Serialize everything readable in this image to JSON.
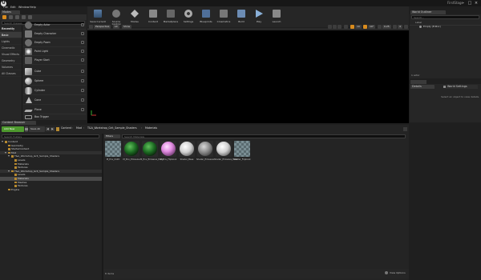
{
  "app": {
    "window_title": "FirstStage",
    "logo_letter": "U",
    "menus": [
      "File",
      "Edit",
      "Window",
      "Help"
    ]
  },
  "modes_tab": "Modes",
  "place_tab": "Place Mode",
  "place_search": "Search Classes",
  "categories": [
    {
      "label": "Recently Placed",
      "bold": true
    },
    {
      "label": "Basic",
      "selected": true
    },
    {
      "label": "Lights"
    },
    {
      "label": "Cinematic"
    },
    {
      "label": "Visual Effects"
    },
    {
      "label": "Geometry"
    },
    {
      "label": "Volumes"
    },
    {
      "label": "All Classes"
    }
  ],
  "place_items": [
    "Empty Actor",
    "Empty Character",
    "Empty Pawn",
    "Point Light",
    "Player Start",
    "Cube",
    "Sphere",
    "Cylinder",
    "Cone",
    "Plane",
    "Box Trigger"
  ],
  "toolbar": [
    {
      "label": "Save Current",
      "icon": "save-icon"
    },
    {
      "label": "Source Control",
      "icon": "source-control-icon"
    },
    {
      "label": "Modes",
      "icon": "modes-icon"
    },
    {
      "label": "Content",
      "icon": "content-icon"
    },
    {
      "label": "Marketplace",
      "icon": "marketplace-icon"
    },
    {
      "label": "Settings",
      "icon": "settings-icon"
    },
    {
      "label": "Blueprints",
      "icon": "blueprints-icon"
    },
    {
      "label": "Cinematics",
      "icon": "cinematics-icon"
    },
    {
      "label": "Build",
      "icon": "build-icon"
    },
    {
      "label": "Play",
      "icon": "play-icon"
    },
    {
      "label": "Launch",
      "icon": "launch-icon"
    }
  ],
  "viewport": {
    "perspective": "Perspective",
    "lit": "Lit",
    "show": "Show",
    "snap_grid": "10",
    "snap_rot": "10°",
    "snap_scale": "0.25",
    "camera_speed": "4"
  },
  "outliner": {
    "tab": "World Outliner",
    "search": "Search...",
    "header": "Label",
    "items": [
      "Empty (Editor)"
    ],
    "count": "1 actor"
  },
  "details": {
    "tab": "Details",
    "world_settings": "World Settings",
    "empty_msg": "Select an object to view details."
  },
  "content_browser": {
    "tab": "Content Browser",
    "add_new": "Add New",
    "import": "Import",
    "save_all": "Save All",
    "breadcrumb": [
      "Content",
      "Mod",
      "T&A_Workshop_Grit_Sample_Shaders",
      "Materials"
    ],
    "search_folders": "Search Folders",
    "filters": "Filters",
    "search_assets": "Search Materials",
    "folders": [
      {
        "label": "Content",
        "depth": 0,
        "expanded": true
      },
      {
        "label": "Geometry",
        "depth": 1
      },
      {
        "label": "StarterContent",
        "depth": 1
      },
      {
        "label": "Mod",
        "depth": 1,
        "expanded": true,
        "highlight": true
      },
      {
        "label": "T&A_Workshop_Grit_Sample_Shaders",
        "depth": 2,
        "expanded": true
      },
      {
        "label": "Levels",
        "depth": 3
      },
      {
        "label": "Materials",
        "depth": 3
      },
      {
        "label": "Textures",
        "depth": 3
      },
      {
        "label": "T&A_Workshop_Grit_Sample_Shaders",
        "depth": 2,
        "expanded": true,
        "highlight": true
      },
      {
        "label": "Levels",
        "depth": 3
      },
      {
        "label": "Materials",
        "depth": 3,
        "selected": true
      },
      {
        "label": "Meshes",
        "depth": 3
      },
      {
        "label": "Textures",
        "depth": 3
      },
      {
        "label": "Engine",
        "depth": 1
      }
    ],
    "assets": [
      {
        "label": "M_Env_Cloth",
        "kind": "checker"
      },
      {
        "label": "M_Env_Emissive",
        "kind": "green"
      },
      {
        "label": "M_Env_Emissive_Mask",
        "kind": "green"
      },
      {
        "label": "M_Env_Flipbook",
        "kind": "pink"
      },
      {
        "label": "Shader_Base",
        "kind": "white"
      },
      {
        "label": "Shader_Emissive",
        "kind": "grey"
      },
      {
        "label": "Shader_Emissive_Mask",
        "kind": "white"
      },
      {
        "label": "Shader_Flipbook",
        "kind": "checker"
      }
    ],
    "status": "8 items",
    "view_options": "View Options"
  },
  "colors": {
    "accent_orange": "#d98c1e",
    "add_new_green": "#4e9a2e",
    "selection": "#444444",
    "viewport_bg": "#000000"
  }
}
